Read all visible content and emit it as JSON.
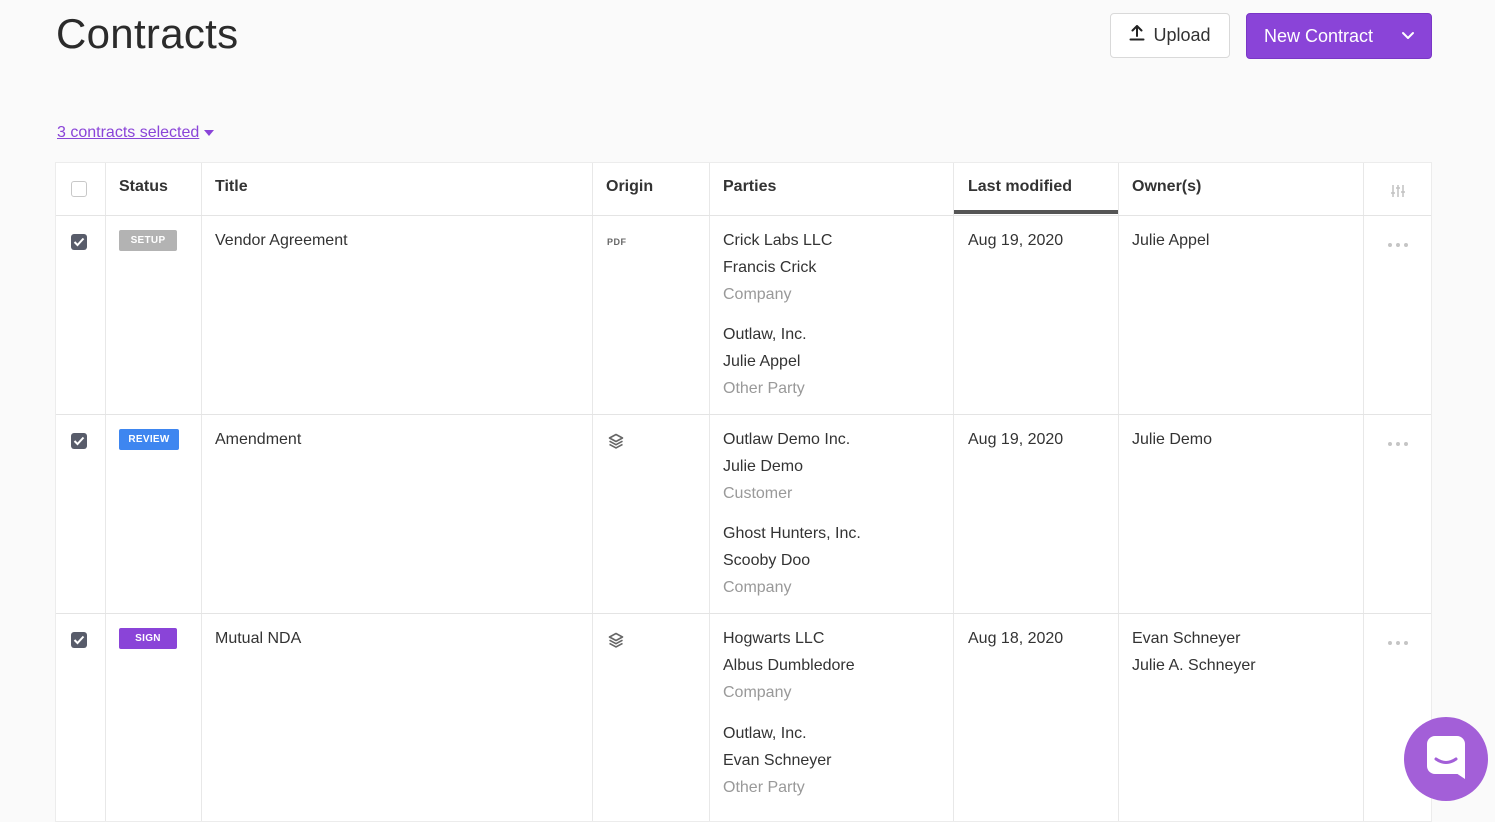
{
  "page": {
    "title": "Contracts"
  },
  "actions": {
    "upload_label": "Upload",
    "new_contract_label": "New Contract"
  },
  "selection": {
    "label": "3 contracts selected"
  },
  "table": {
    "columns": [
      "Status",
      "Title",
      "Origin",
      "Parties",
      "Last modified",
      "Owner(s)"
    ],
    "sorted_column": "Last modified",
    "rows": [
      {
        "checked": true,
        "status": "SETUP",
        "title": "Vendor Agreement",
        "origin": "PDF",
        "parties": [
          {
            "org": "Crick Labs LLC",
            "person": "Francis Crick",
            "role": "Company"
          },
          {
            "org": "Outlaw, Inc.",
            "person": "Julie Appel",
            "role": "Other Party"
          }
        ],
        "modified": "Aug 19, 2020",
        "owners": [
          "Julie Appel"
        ]
      },
      {
        "checked": true,
        "status": "REVIEW",
        "title": "Amendment",
        "origin": "layers-icon",
        "parties": [
          {
            "org": "Outlaw Demo Inc.",
            "person": "Julie Demo",
            "role": "Customer"
          },
          {
            "org": "Ghost Hunters, Inc.",
            "person": "Scooby Doo",
            "role": "Company"
          }
        ],
        "modified": "Aug 19, 2020",
        "owners": [
          "Julie Demo"
        ]
      },
      {
        "checked": true,
        "status": "SIGN",
        "title": "Mutual NDA",
        "origin": "layers-icon",
        "parties": [
          {
            "org": "Hogwarts LLC",
            "person": "Albus Dumbledore",
            "role": "Company"
          },
          {
            "org": "Outlaw, Inc.",
            "person": "Evan Schneyer",
            "role": "Other Party"
          }
        ],
        "modified": "Aug 18, 2020",
        "owners": [
          "Evan Schneyer",
          "Julie A. Schneyer"
        ]
      }
    ]
  },
  "colors": {
    "accent": "#8a44d8",
    "status_setup": "#b3b3b3",
    "status_review": "#3e86f0",
    "status_sign": "#8a44d8"
  }
}
